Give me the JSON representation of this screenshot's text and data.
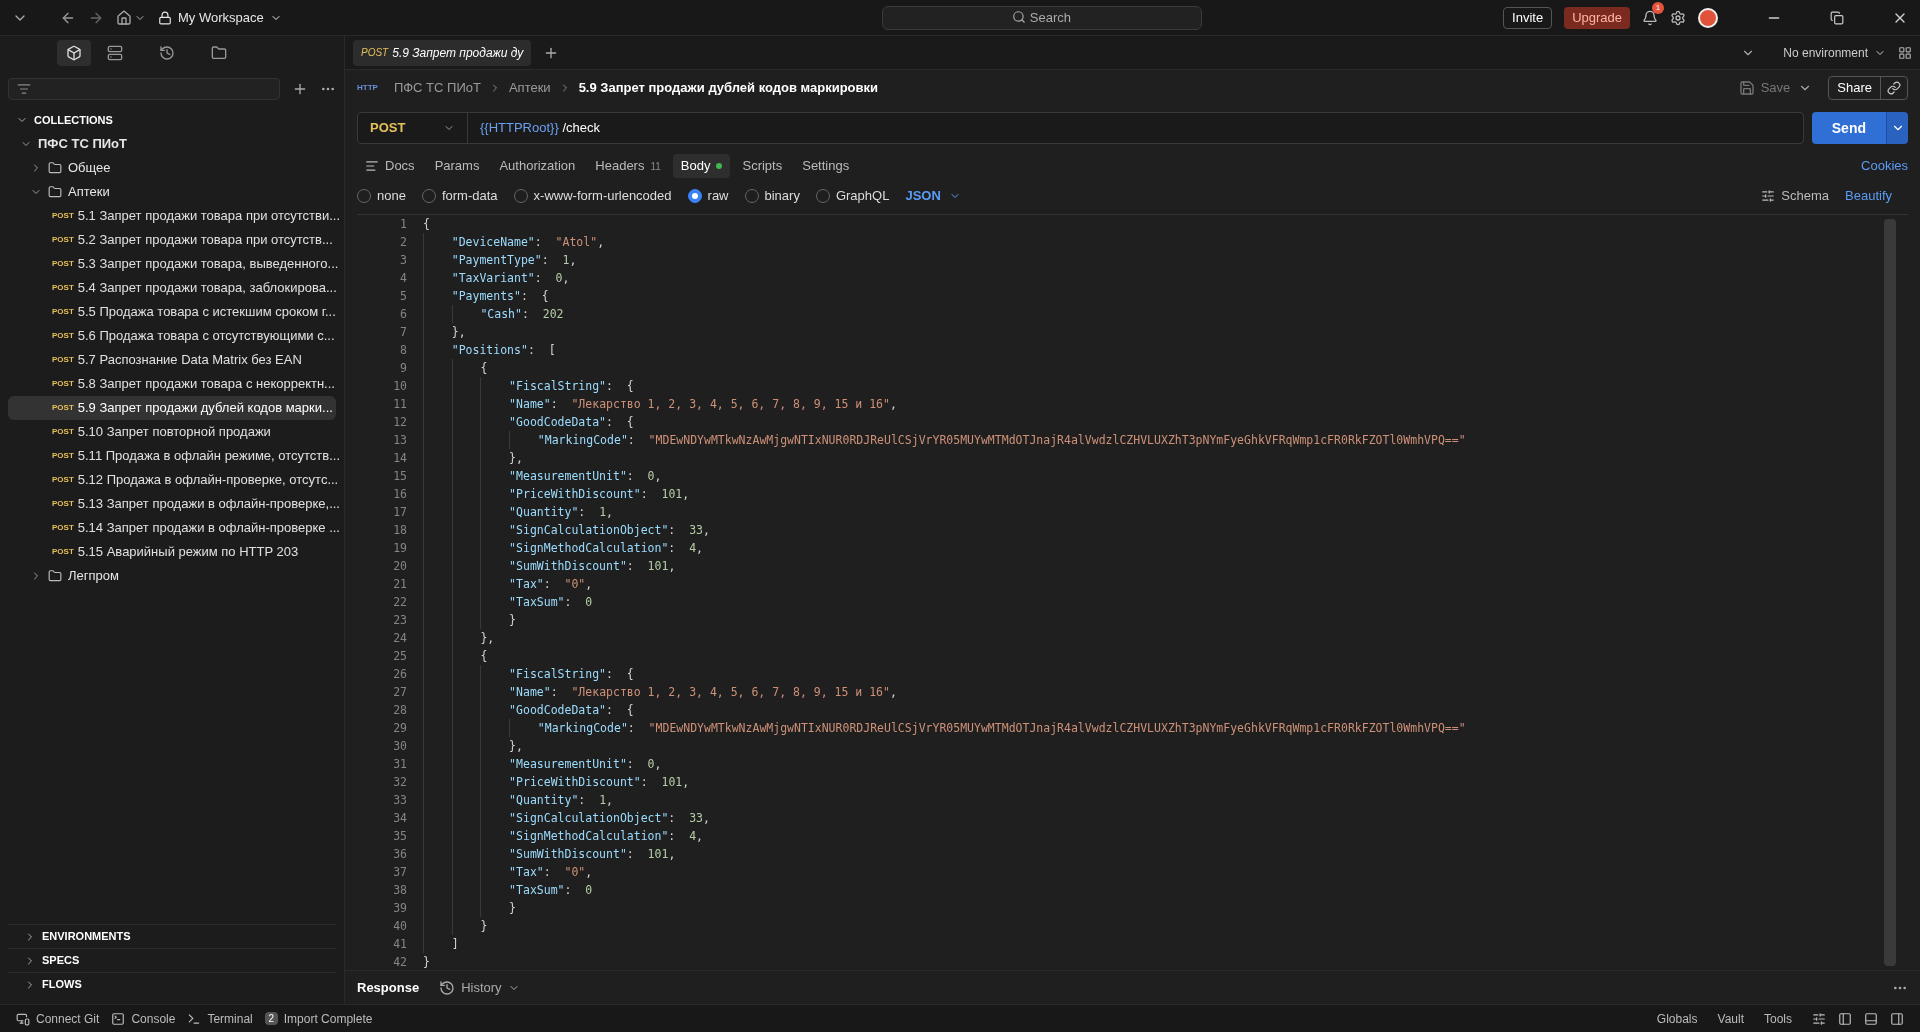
{
  "titlebar": {
    "workspace": "My Workspace",
    "search_placeholder": "Search",
    "invite": "Invite",
    "upgrade": "Upgrade",
    "notifications": "1"
  },
  "sidebar": {
    "section": "COLLECTIONS",
    "section_expanded": true,
    "tree": [
      {
        "kind": "collection",
        "label": "ПФС ТС ПИоТ",
        "expanded": true,
        "children": [
          {
            "kind": "folder",
            "label": "Общее",
            "expanded": false
          },
          {
            "kind": "folder",
            "label": "Аптеки",
            "expanded": true,
            "children": [
              {
                "kind": "request",
                "method": "POST",
                "label": "5.1 Запрет продажи товара при отсутстви...",
                "selected": false
              },
              {
                "kind": "request",
                "method": "POST",
                "label": "5.2 Запрет продажи товара при отсутств...",
                "selected": false
              },
              {
                "kind": "request",
                "method": "POST",
                "label": "5.3 Запрет продажи товара, выведенного...",
                "selected": false
              },
              {
                "kind": "request",
                "method": "POST",
                "label": "5.4 Запрет продажи товара, заблокирова...",
                "selected": false
              },
              {
                "kind": "request",
                "method": "POST",
                "label": "5.5 Продажа товара с истекшим сроком г...",
                "selected": false
              },
              {
                "kind": "request",
                "method": "POST",
                "label": "5.6 Продажа товара с отсутствующими с...",
                "selected": false
              },
              {
                "kind": "request",
                "method": "POST",
                "label": "5.7 Распознание Data Matrix без EAN",
                "selected": false
              },
              {
                "kind": "request",
                "method": "POST",
                "label": "5.8 Запрет продажи товара с некорректн...",
                "selected": false
              },
              {
                "kind": "request",
                "method": "POST",
                "label": "5.9 Запрет продажи дублей кодов марки...",
                "selected": true
              },
              {
                "kind": "request",
                "method": "POST",
                "label": "5.10 Запрет повторной продажи",
                "selected": false
              },
              {
                "kind": "request",
                "method": "POST",
                "label": "5.11 Продажа в офлайн режиме, отсутств...",
                "selected": false
              },
              {
                "kind": "request",
                "method": "POST",
                "label": "5.12 Продажа в офлайн-проверке, отсутс...",
                "selected": false
              },
              {
                "kind": "request",
                "method": "POST",
                "label": "5.13 Запрет продажи в офлайн-проверке,...",
                "selected": false
              },
              {
                "kind": "request",
                "method": "POST",
                "label": "5.14 Запрет продажи в офлайн-проверке ...",
                "selected": false
              },
              {
                "kind": "request",
                "method": "POST",
                "label": "5.15 Аварийный режим по HTTP 203",
                "selected": false
              }
            ]
          },
          {
            "kind": "folder",
            "label": "Легпром",
            "expanded": false
          }
        ]
      }
    ],
    "bottom_sections": [
      {
        "label": "ENVIRONMENTS",
        "expanded": false
      },
      {
        "label": "SPECS",
        "expanded": false
      },
      {
        "label": "FLOWS",
        "expanded": false
      }
    ]
  },
  "open_tab": {
    "method": "POST",
    "title": "5.9 Запрет продажи ду"
  },
  "environment": "No environment",
  "http_badge": "HTTP",
  "breadcrumb": [
    "ПФС ТС ПИоТ",
    "Аптеки",
    "5.9 Запрет продажи дублей кодов маркировки"
  ],
  "save": "Save",
  "share": "Share",
  "request": {
    "method": "POST",
    "url_variable": "{{HTTPRoot}}",
    "url_path": "/check",
    "send": "Send"
  },
  "tabs": [
    {
      "label": "Docs",
      "selected": false
    },
    {
      "label": "Params",
      "selected": false
    },
    {
      "label": "Authorization",
      "selected": false
    },
    {
      "label": "Headers",
      "count": "11",
      "selected": false
    },
    {
      "label": "Body",
      "selected": true,
      "dot": true
    },
    {
      "label": "Scripts",
      "selected": false
    },
    {
      "label": "Settings",
      "selected": false
    }
  ],
  "cookies": "Cookies",
  "body_types": [
    {
      "label": "none",
      "selected": false
    },
    {
      "label": "form-data",
      "selected": false
    },
    {
      "label": "x-www-form-urlencoded",
      "selected": false
    },
    {
      "label": "raw",
      "selected": true
    },
    {
      "label": "binary",
      "selected": false
    },
    {
      "label": "GraphQL",
      "selected": false
    }
  ],
  "body_format": "JSON",
  "schema": "Schema",
  "beautify": "Beautify",
  "code": [
    {
      "n": "1",
      "tokens": [
        {
          "kind": "punct",
          "text": "{"
        }
      ]
    },
    {
      "n": "2",
      "tokens": [
        {
          "kind": "key",
          "text": "    \"DeviceName\""
        },
        {
          "kind": "punct",
          "text": ":  "
        },
        {
          "kind": "string",
          "text": "\"Atol\""
        },
        {
          "kind": "punct",
          "text": ","
        }
      ]
    },
    {
      "n": "3",
      "tokens": [
        {
          "kind": "key",
          "text": "    \"PaymentType\""
        },
        {
          "kind": "punct",
          "text": ":  "
        },
        {
          "kind": "number",
          "text": "1"
        },
        {
          "kind": "punct",
          "text": ","
        }
      ]
    },
    {
      "n": "4",
      "tokens": [
        {
          "kind": "key",
          "text": "    \"TaxVariant\""
        },
        {
          "kind": "punct",
          "text": ":  "
        },
        {
          "kind": "number",
          "text": "0"
        },
        {
          "kind": "punct",
          "text": ","
        }
      ]
    },
    {
      "n": "5",
      "tokens": [
        {
          "kind": "key",
          "text": "    \"Payments\""
        },
        {
          "kind": "punct",
          "text": ":  {"
        }
      ]
    },
    {
      "n": "6",
      "tokens": [
        {
          "kind": "key",
          "text": "        \"Cash\""
        },
        {
          "kind": "punct",
          "text": ":  "
        },
        {
          "kind": "number",
          "text": "202"
        }
      ]
    },
    {
      "n": "7",
      "tokens": [
        {
          "kind": "punct",
          "text": "    },"
        }
      ]
    },
    {
      "n": "8",
      "tokens": [
        {
          "kind": "key",
          "text": "    \"Positions\""
        },
        {
          "kind": "punct",
          "text": ":  ["
        }
      ]
    },
    {
      "n": "9",
      "tokens": [
        {
          "kind": "punct",
          "text": "        {"
        }
      ]
    },
    {
      "n": "10",
      "tokens": [
        {
          "kind": "key",
          "text": "            \"FiscalString\""
        },
        {
          "kind": "punct",
          "text": ":  {"
        }
      ]
    },
    {
      "n": "11",
      "tokens": [
        {
          "kind": "key",
          "text": "            \"Name\""
        },
        {
          "kind": "punct",
          "text": ":  "
        },
        {
          "kind": "string",
          "text": "\"Лекарство 1, 2, 3, 4, 5, 6, 7, 8, 9, 15 и 16\""
        },
        {
          "kind": "punct",
          "text": ","
        }
      ]
    },
    {
      "n": "12",
      "tokens": [
        {
          "kind": "key",
          "text": "            \"GoodCodeData\""
        },
        {
          "kind": "punct",
          "text": ":  {"
        }
      ]
    },
    {
      "n": "13",
      "tokens": [
        {
          "kind": "key",
          "text": "                \"MarkingCode\""
        },
        {
          "kind": "punct",
          "text": ":  "
        },
        {
          "kind": "string",
          "text": "\"MDEwNDYwMTkwNzAwMjgwNTIxNUR0RDJReUlCSjVrYR05MUYwMTMdOTJnajR4alVwdzlCZHVLUXZhT3pNYmFyeGhkVFRqWmp1cFR0RkFZOTl0WmhVPQ==\""
        }
      ]
    },
    {
      "n": "14",
      "tokens": [
        {
          "kind": "punct",
          "text": "            },"
        }
      ]
    },
    {
      "n": "15",
      "tokens": [
        {
          "kind": "key",
          "text": "            \"MeasurementUnit\""
        },
        {
          "kind": "punct",
          "text": ":  "
        },
        {
          "kind": "number",
          "text": "0"
        },
        {
          "kind": "punct",
          "text": ","
        }
      ]
    },
    {
      "n": "16",
      "tokens": [
        {
          "kind": "key",
          "text": "            \"PriceWithDiscount\""
        },
        {
          "kind": "punct",
          "text": ":  "
        },
        {
          "kind": "number",
          "text": "101"
        },
        {
          "kind": "punct",
          "text": ","
        }
      ]
    },
    {
      "n": "17",
      "tokens": [
        {
          "kind": "key",
          "text": "            \"Quantity\""
        },
        {
          "kind": "punct",
          "text": ":  "
        },
        {
          "kind": "number",
          "text": "1"
        },
        {
          "kind": "punct",
          "text": ","
        }
      ]
    },
    {
      "n": "18",
      "tokens": [
        {
          "kind": "key",
          "text": "            \"SignCalculationObject\""
        },
        {
          "kind": "punct",
          "text": ":  "
        },
        {
          "kind": "number",
          "text": "33"
        },
        {
          "kind": "punct",
          "text": ","
        }
      ]
    },
    {
      "n": "19",
      "tokens": [
        {
          "kind": "key",
          "text": "            \"SignMethodCalculation\""
        },
        {
          "kind": "punct",
          "text": ":  "
        },
        {
          "kind": "number",
          "text": "4"
        },
        {
          "kind": "punct",
          "text": ","
        }
      ]
    },
    {
      "n": "20",
      "tokens": [
        {
          "kind": "key",
          "text": "            \"SumWithDiscount\""
        },
        {
          "kind": "punct",
          "text": ":  "
        },
        {
          "kind": "number",
          "text": "101"
        },
        {
          "kind": "punct",
          "text": ","
        }
      ]
    },
    {
      "n": "21",
      "tokens": [
        {
          "kind": "key",
          "text": "            \"Tax\""
        },
        {
          "kind": "punct",
          "text": ":  "
        },
        {
          "kind": "string",
          "text": "\"0\""
        },
        {
          "kind": "punct",
          "text": ","
        }
      ]
    },
    {
      "n": "22",
      "tokens": [
        {
          "kind": "key",
          "text": "            \"TaxSum\""
        },
        {
          "kind": "punct",
          "text": ":  "
        },
        {
          "kind": "number",
          "text": "0"
        }
      ]
    },
    {
      "n": "23",
      "tokens": [
        {
          "kind": "punct",
          "text": "            }"
        }
      ]
    },
    {
      "n": "24",
      "tokens": [
        {
          "kind": "punct",
          "text": "        },"
        }
      ]
    },
    {
      "n": "25",
      "tokens": [
        {
          "kind": "punct",
          "text": "        {"
        }
      ]
    },
    {
      "n": "26",
      "tokens": [
        {
          "kind": "key",
          "text": "            \"FiscalString\""
        },
        {
          "kind": "punct",
          "text": ":  {"
        }
      ]
    },
    {
      "n": "27",
      "tokens": [
        {
          "kind": "key",
          "text": "            \"Name\""
        },
        {
          "kind": "punct",
          "text": ":  "
        },
        {
          "kind": "string",
          "text": "\"Лекарство 1, 2, 3, 4, 5, 6, 7, 8, 9, 15 и 16\""
        },
        {
          "kind": "punct",
          "text": ","
        }
      ]
    },
    {
      "n": "28",
      "tokens": [
        {
          "kind": "key",
          "text": "            \"GoodCodeData\""
        },
        {
          "kind": "punct",
          "text": ":  {"
        }
      ]
    },
    {
      "n": "29",
      "tokens": [
        {
          "kind": "key",
          "text": "                \"MarkingCode\""
        },
        {
          "kind": "punct",
          "text": ":  "
        },
        {
          "kind": "string",
          "text": "\"MDEwNDYwMTkwNzAwMjgwNTIxNUR0RDJReUlCSjVrYR05MUYwMTMdOTJnajR4alVwdzlCZHVLUXZhT3pNYmFyeGhkVFRqWmp1cFR0RkFZOTl0WmhVPQ==\""
        }
      ]
    },
    {
      "n": "30",
      "tokens": [
        {
          "kind": "punct",
          "text": "            },"
        }
      ]
    },
    {
      "n": "31",
      "tokens": [
        {
          "kind": "key",
          "text": "            \"MeasurementUnit\""
        },
        {
          "kind": "punct",
          "text": ":  "
        },
        {
          "kind": "number",
          "text": "0"
        },
        {
          "kind": "punct",
          "text": ","
        }
      ]
    },
    {
      "n": "32",
      "tokens": [
        {
          "kind": "key",
          "text": "            \"PriceWithDiscount\""
        },
        {
          "kind": "punct",
          "text": ":  "
        },
        {
          "kind": "number",
          "text": "101"
        },
        {
          "kind": "punct",
          "text": ","
        }
      ]
    },
    {
      "n": "33",
      "tokens": [
        {
          "kind": "key",
          "text": "            \"Quantity\""
        },
        {
          "kind": "punct",
          "text": ":  "
        },
        {
          "kind": "number",
          "text": "1"
        },
        {
          "kind": "punct",
          "text": ","
        }
      ]
    },
    {
      "n": "34",
      "tokens": [
        {
          "kind": "key",
          "text": "            \"SignCalculationObject\""
        },
        {
          "kind": "punct",
          "text": ":  "
        },
        {
          "kind": "number",
          "text": "33"
        },
        {
          "kind": "punct",
          "text": ","
        }
      ]
    },
    {
      "n": "35",
      "tokens": [
        {
          "kind": "key",
          "text": "            \"SignMethodCalculation\""
        },
        {
          "kind": "punct",
          "text": ":  "
        },
        {
          "kind": "number",
          "text": "4"
        },
        {
          "kind": "punct",
          "text": ","
        }
      ]
    },
    {
      "n": "36",
      "tokens": [
        {
          "kind": "key",
          "text": "            \"SumWithDiscount\""
        },
        {
          "kind": "punct",
          "text": ":  "
        },
        {
          "kind": "number",
          "text": "101"
        },
        {
          "kind": "punct",
          "text": ","
        }
      ]
    },
    {
      "n": "37",
      "tokens": [
        {
          "kind": "key",
          "text": "            \"Tax\""
        },
        {
          "kind": "punct",
          "text": ":  "
        },
        {
          "kind": "string",
          "text": "\"0\""
        },
        {
          "kind": "punct",
          "text": ","
        }
      ]
    },
    {
      "n": "38",
      "tokens": [
        {
          "kind": "key",
          "text": "            \"TaxSum\""
        },
        {
          "kind": "punct",
          "text": ":  "
        },
        {
          "kind": "number",
          "text": "0"
        }
      ]
    },
    {
      "n": "39",
      "tokens": [
        {
          "kind": "punct",
          "text": "            }"
        }
      ]
    },
    {
      "n": "40",
      "tokens": [
        {
          "kind": "punct",
          "text": "        }"
        }
      ]
    },
    {
      "n": "41",
      "tokens": [
        {
          "kind": "punct",
          "text": "    ]"
        }
      ]
    },
    {
      "n": "42",
      "tokens": [
        {
          "kind": "punct",
          "text": "}"
        }
      ]
    }
  ],
  "response_bar": {
    "title": "Response",
    "history": "History"
  },
  "status_left": [
    {
      "label": "Connect Git",
      "kind": "git"
    },
    {
      "label": "Console",
      "kind": "console"
    },
    {
      "label": "Terminal",
      "kind": "terminal"
    },
    {
      "label": "Import Complete",
      "kind": "badge",
      "badge": "2"
    }
  ],
  "status_right": [
    "Globals",
    "Vault",
    "Tools"
  ]
}
